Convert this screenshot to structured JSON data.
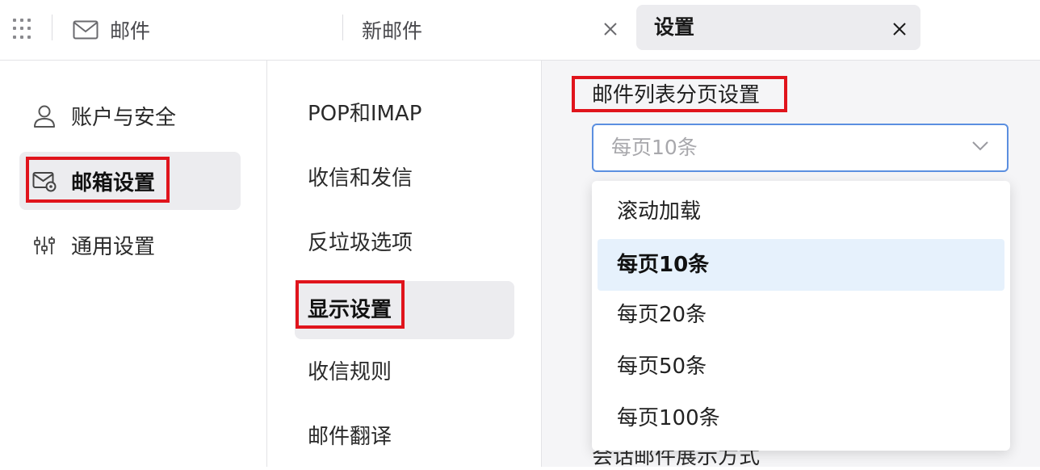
{
  "topbar": {
    "tabs": [
      {
        "label": "邮件",
        "icon": "mail-icon"
      },
      {
        "label": "新邮件"
      },
      {
        "label": "设置",
        "active": true
      }
    ]
  },
  "sidebar": {
    "items": [
      {
        "label": "账户与安全",
        "icon": "user-icon"
      },
      {
        "label": "邮箱设置",
        "icon": "mailbox-settings-icon",
        "active": true
      },
      {
        "label": "通用设置",
        "icon": "sliders-icon"
      }
    ]
  },
  "submenu": {
    "items": [
      {
        "label": "POP和IMAP"
      },
      {
        "label": "收信和发信"
      },
      {
        "label": "反垃圾选项"
      },
      {
        "label": "显示设置",
        "active": true
      },
      {
        "label": "收信规则"
      },
      {
        "label": "邮件翻译"
      }
    ]
  },
  "content": {
    "section_title": "邮件列表分页设置",
    "select": {
      "value": "每页10条"
    },
    "dropdown": {
      "options": [
        "滚动加载",
        "每页10条",
        "每页20条",
        "每页50条",
        "每页100条"
      ],
      "selected_index": 1
    },
    "next_section_title": "会话邮件展示方式"
  },
  "colors": {
    "highlight": "#e0141c",
    "accent": "#5b8fe0",
    "selected_option_bg": "#e6f1fc"
  }
}
